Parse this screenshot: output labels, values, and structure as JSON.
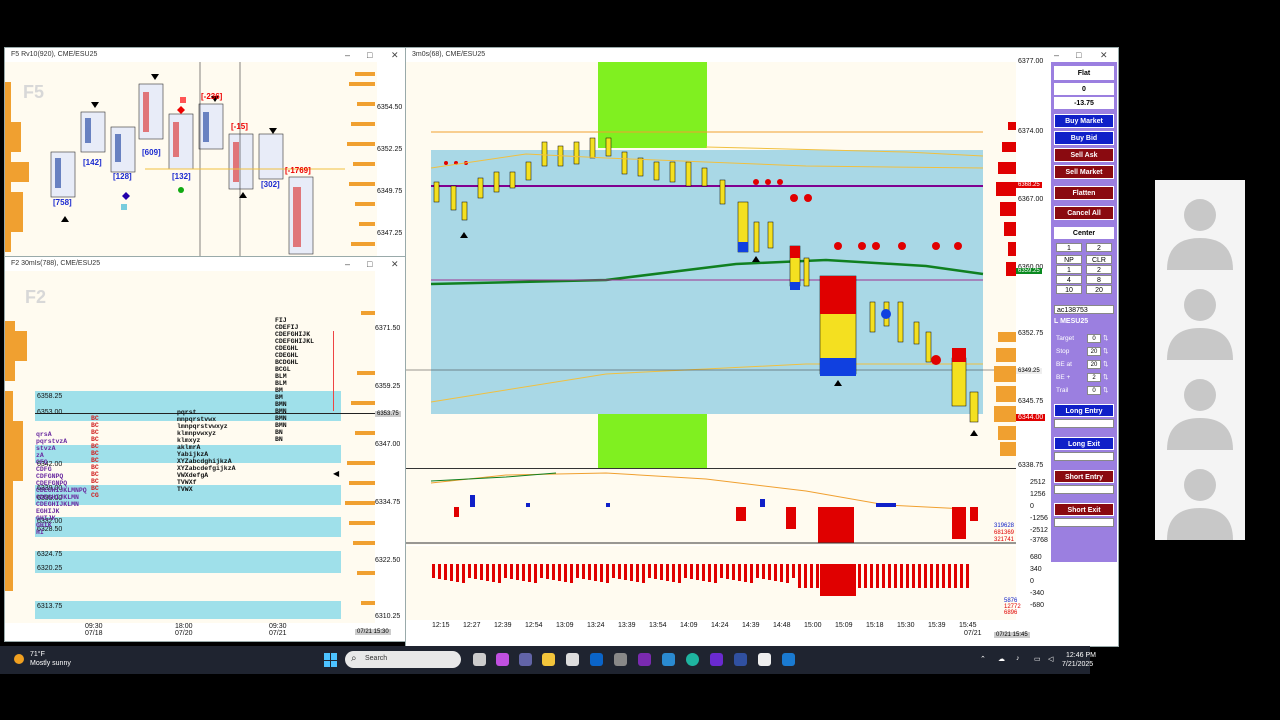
{
  "windows": {
    "f5": {
      "title": "F5 Rv10(920), CME/ESU25",
      "watermark": "F5",
      "prices": [
        "6354.50",
        "6352.25",
        "6349.75",
        "6347.25"
      ],
      "labels_blue": [
        "[758]",
        "[142]",
        "[128]",
        "[609]",
        "[132]",
        "[302]"
      ],
      "labels_red": [
        "[-236]",
        "[-15]",
        "[-1769]"
      ]
    },
    "f2": {
      "title": "F2 30mIs(788), CME/ESU25",
      "watermark": "F2",
      "prices": [
        "6371.50",
        "6359.25",
        "6347.00",
        "6334.75",
        "6322.50",
        "6310.25"
      ],
      "levels": [
        "6358.25",
        "6353.00",
        "6342.00",
        "6339.00",
        "6335.00",
        "6332.00",
        "6328.50",
        "6324.75",
        "6320.25",
        "6313.75"
      ],
      "current_price": "6353.75",
      "times": [
        [
          "09:30",
          "07/18"
        ],
        [
          "18:00",
          "07/20"
        ],
        [
          "09:30",
          "07/21"
        ]
      ],
      "footer_date": "07/21 15:30",
      "tpo_left": [
        "qrsA",
        "pqrstvzA",
        "stvzA",
        "zA",
        "",
        "CFG",
        "CDFG",
        "CDFGNPQ",
        "CDEFGNPQ",
        "CDEGHIJKLMNPQ",
        "CDEGHIJKLMN",
        "CDEGHIJKLMN",
        "EGHIJK",
        "GHIJK",
        "GHIK",
        "HI"
      ],
      "tpo_mid": [
        "BC",
        "BC",
        "BC",
        "BC",
        "BC",
        "BC",
        "BC",
        "BC",
        "BC",
        "BC",
        "BC",
        "CG"
      ],
      "tpo_right": [
        "FIJ",
        "CDEFIJ",
        "CDEFGHIJK",
        "CDEFGHIJKL",
        "CDEGHL",
        "CDEGHL",
        "BCDGHL",
        "BCGL",
        "BLM",
        "BLM",
        "BM",
        "BM",
        "BMN",
        "BMN",
        "BMN",
        "BMN",
        "BN",
        "BN"
      ],
      "tpo_m2": [
        "pqrst",
        "mnpqrstvwx",
        "lmnpqrstvwxyz",
        "klmnpvwxyz",
        "klmxyz",
        "aklmrA",
        "YabijkzA",
        "XYZabcdghijkzA",
        "XYZabcdefgijkzA",
        "VWXdefgA",
        "TVWXf",
        "TVWX"
      ]
    },
    "main": {
      "title": "3m0s(68), CME/ESU25",
      "prices": [
        "6377.00",
        "6374.00",
        "6367.00",
        "6360.00",
        "6352.75",
        "6345.75",
        "6338.75"
      ],
      "price_tags": [
        {
          "v": "6368.25",
          "c": "#e00000"
        },
        {
          "v": "6359.25",
          "c": "#0a8a20"
        },
        {
          "v": "6349.25",
          "c": "#ffffff"
        },
        {
          "v": "6344.00",
          "c": "#e00000"
        }
      ],
      "times": [
        "12:15",
        "12:27",
        "12:39",
        "12:54",
        "13:09",
        "13:24",
        "13:39",
        "13:54",
        "14:09",
        "14:24",
        "14:39",
        "14:48",
        "15:00",
        "15:09",
        "15:18",
        "15:30",
        "15:39",
        "15:45"
      ],
      "footer_date": "07/21",
      "footer_date2": "07/21 15:45",
      "ind1_ticks": [
        "2512",
        "1256",
        "0",
        "-1256",
        "-2512",
        "-3768"
      ],
      "ind1_vals": [
        "319628",
        "681369",
        "321741"
      ],
      "ind2_ticks": [
        "680",
        "340",
        "0",
        "-340",
        "-680"
      ],
      "ind2_vals": [
        "5876",
        "12772",
        "6896"
      ]
    }
  },
  "panel": {
    "status": "Flat",
    "position": "0",
    "pnl": "-13.75",
    "buy_market": "Buy Market",
    "buy_bid": "Buy Bid",
    "sell_ask": "Sell Ask",
    "sell_market": "Sell Market",
    "flatten": "Flatten",
    "cancel_all": "Cancel All",
    "center": "Center",
    "qty_row": [
      "1",
      "2"
    ],
    "grid": [
      [
        "NP",
        "CLR"
      ],
      [
        "1",
        "2"
      ],
      [
        "4",
        "8"
      ],
      [
        "10",
        "20"
      ]
    ],
    "account": "ac138753",
    "instrument": "L MESU25",
    "fields": [
      {
        "label": "Target",
        "value": "0"
      },
      {
        "label": "Stop",
        "value": "20"
      },
      {
        "label": "BE at",
        "value": "20"
      },
      {
        "label": "BE +",
        "value": "2"
      },
      {
        "label": "Trail",
        "value": "0"
      }
    ],
    "long_entry": "Long Entry",
    "long_exit": "Long Exit",
    "short_entry": "Short Entry",
    "short_exit": "Short Exit"
  },
  "taskbar": {
    "weather_temp": "71°F",
    "weather_text": "Mostly sunny",
    "search_placeholder": "Search",
    "time": "12:46 PM",
    "date": "7/21/2025"
  }
}
